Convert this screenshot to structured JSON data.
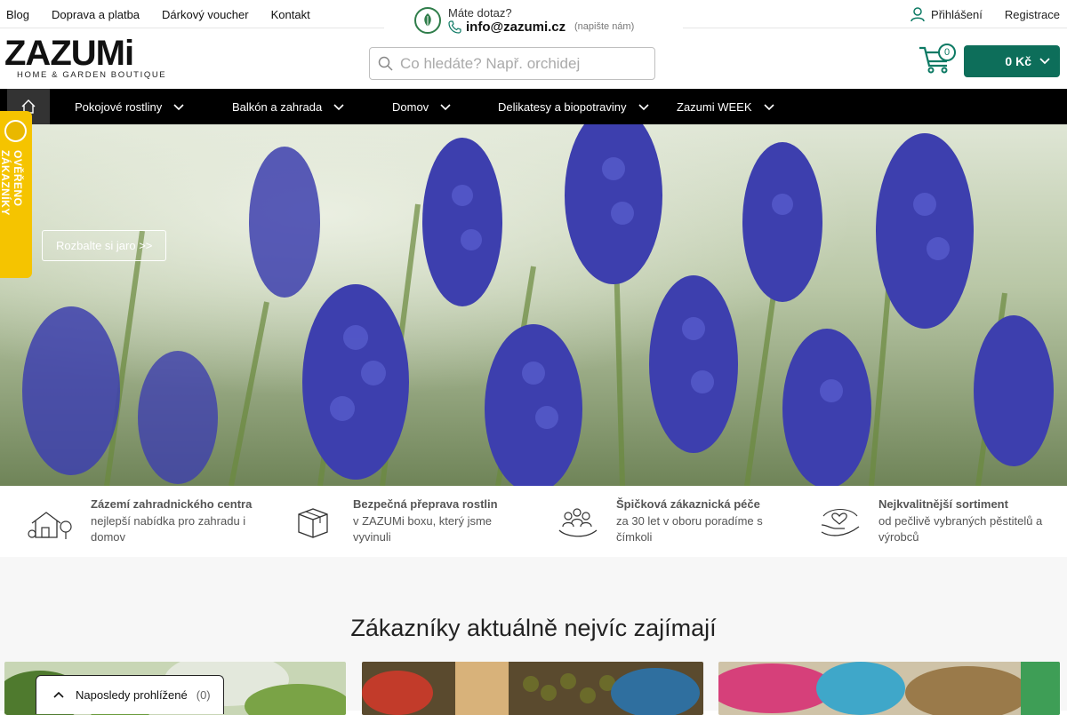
{
  "topbar": {
    "links": [
      "Blog",
      "Doprava a platba",
      "Dárkový voucher",
      "Kontakt"
    ],
    "contact_question": "Máte dotaz?",
    "contact_email": "info@zazumi.cz",
    "contact_note": "(napište nám)",
    "login_label": "Přihlášení",
    "register_label": "Registrace"
  },
  "header": {
    "logo_word": "ZAZUMi",
    "logo_sub": "HOME & GARDEN BOUTIQUE",
    "search_placeholder": "Co hledáte? Např. orchidej",
    "cart_count": "0",
    "cart_total": "0 Kč"
  },
  "nav": {
    "items": [
      "Pokojové rostliny",
      "Balkón a zahrada",
      "Domov",
      "Delikatesy a biopotraviny",
      "Zazumi WEEK"
    ]
  },
  "hero": {
    "button_label": "Rozbalte si jaro >>"
  },
  "badge": {
    "label": "OVĚŘENO ZÁKAZNÍKY"
  },
  "features": [
    {
      "title": "Zázemí zahradnického centra",
      "desc": "nejlepší nabídka pro zahradu i domov",
      "icon": "house-garden-icon"
    },
    {
      "title": "Bezpečná přeprava rostlin",
      "desc": "v ZAZUMi boxu, který jsme vyvinuli",
      "icon": "box-icon"
    },
    {
      "title": "Špičková zákaznická péče",
      "desc": "za 30 let v oboru poradíme s čímkoli",
      "icon": "people-care-icon"
    },
    {
      "title": "Nejkvalitnější sortiment",
      "desc": "od pečlivě vybraných pěstitelů a výrobců",
      "icon": "hand-heart-icon"
    }
  ],
  "section": {
    "title": "Zákazníky aktuálně nejvíc zajímají"
  },
  "recent": {
    "label": "Naposledy prohlížené",
    "count": "(0)"
  },
  "colors": {
    "accent": "#0d6e5a",
    "nav_bg": "#000000",
    "badge": "#f5c400"
  }
}
